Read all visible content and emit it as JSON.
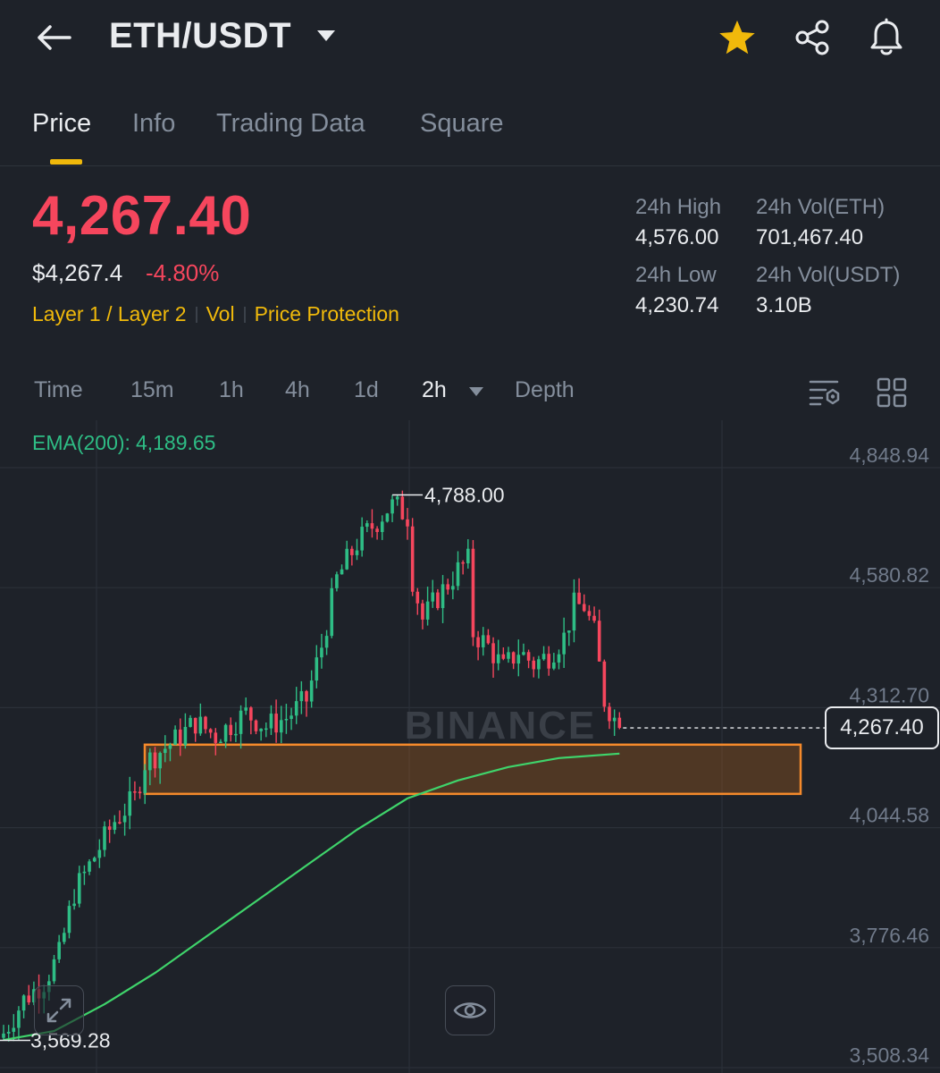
{
  "header": {
    "pair": "ETH/USDT",
    "icons": [
      "back-arrow-icon",
      "caret-down-icon",
      "star-icon",
      "share-icon",
      "bell-icon"
    ],
    "favorite_color": "#f0b90b"
  },
  "tabs": [
    {
      "label": "Price",
      "active": true
    },
    {
      "label": "Info"
    },
    {
      "label": "Trading Data"
    },
    {
      "label": "Square"
    }
  ],
  "ticker": {
    "last_price": "4,267.40",
    "fiat_price": "$4,267.4",
    "change": "-4.80%",
    "tags": [
      "Layer 1 / Layer 2",
      "Vol",
      "Price Protection"
    ],
    "stats": {
      "high_label": "24h High",
      "high_value": "4,576.00",
      "low_label": "24h Low",
      "low_value": "4,230.74",
      "vol_base_label": "24h Vol(ETH)",
      "vol_base_value": "701,467.40",
      "vol_quote_label": "24h Vol(USDT)",
      "vol_quote_value": "3.10B"
    }
  },
  "intervals": {
    "items": [
      "Time",
      "15m",
      "1h",
      "4h",
      "1d",
      "2h",
      "Depth"
    ],
    "selected": "2h"
  },
  "colors": {
    "up": "#2ebd85",
    "down": "#f6465d",
    "accent": "#f0b90b",
    "ema": "#3fd46b",
    "zone_border": "#f58a2b"
  },
  "chart_data": {
    "type": "candlestick",
    "symbol": "ETH/USDT",
    "interval": "2h",
    "watermark": "BINANCE",
    "indicator": {
      "name": "EMA(200):",
      "value": "4,189.65"
    },
    "y_ticks": [
      "4,848.94",
      "4,580.82",
      "4,312.70",
      "4,044.58",
      "3,776.46",
      "3,508.34"
    ],
    "ylim": [
      3508.34,
      4848.94
    ],
    "current_price": "4,267.40",
    "current_price_value": 4267.4,
    "high_marker": {
      "label": "4,788.00",
      "value": 4788.0
    },
    "low_marker": {
      "label": "3,569.28",
      "value": 3569.28
    },
    "support_zone": [
      4120,
      4230
    ],
    "close_path": [
      [
        0,
        3585
      ],
      [
        4,
        3660
      ],
      [
        8,
        3700
      ],
      [
        11,
        3760
      ],
      [
        14,
        3900
      ],
      [
        18,
        3980
      ],
      [
        22,
        4060
      ],
      [
        26,
        4110
      ],
      [
        28,
        4190
      ],
      [
        34,
        4240
      ],
      [
        38,
        4280
      ],
      [
        42,
        4250
      ],
      [
        48,
        4300
      ],
      [
        52,
        4270
      ],
      [
        56,
        4290
      ],
      [
        60,
        4330
      ],
      [
        63,
        4450
      ],
      [
        66,
        4600
      ],
      [
        70,
        4680
      ],
      [
        74,
        4730
      ],
      [
        77,
        4770
      ],
      [
        80,
        4740
      ],
      [
        81,
        4600
      ],
      [
        83,
        4510
      ],
      [
        86,
        4560
      ],
      [
        90,
        4620
      ],
      [
        92,
        4640
      ],
      [
        93,
        4480
      ],
      [
        96,
        4450
      ],
      [
        99,
        4400
      ],
      [
        102,
        4440
      ],
      [
        105,
        4410
      ],
      [
        108,
        4430
      ],
      [
        111,
        4470
      ],
      [
        113,
        4540
      ],
      [
        115,
        4540
      ],
      [
        117,
        4480
      ],
      [
        119,
        4330
      ],
      [
        122,
        4267.4
      ]
    ],
    "ema_path": [
      [
        0,
        3570
      ],
      [
        10,
        3590
      ],
      [
        20,
        3650
      ],
      [
        30,
        3720
      ],
      [
        40,
        3800
      ],
      [
        50,
        3880
      ],
      [
        60,
        3960
      ],
      [
        70,
        4040
      ],
      [
        80,
        4110
      ],
      [
        90,
        4150
      ],
      [
        100,
        4180
      ],
      [
        110,
        4200
      ],
      [
        122,
        4210
      ]
    ]
  }
}
